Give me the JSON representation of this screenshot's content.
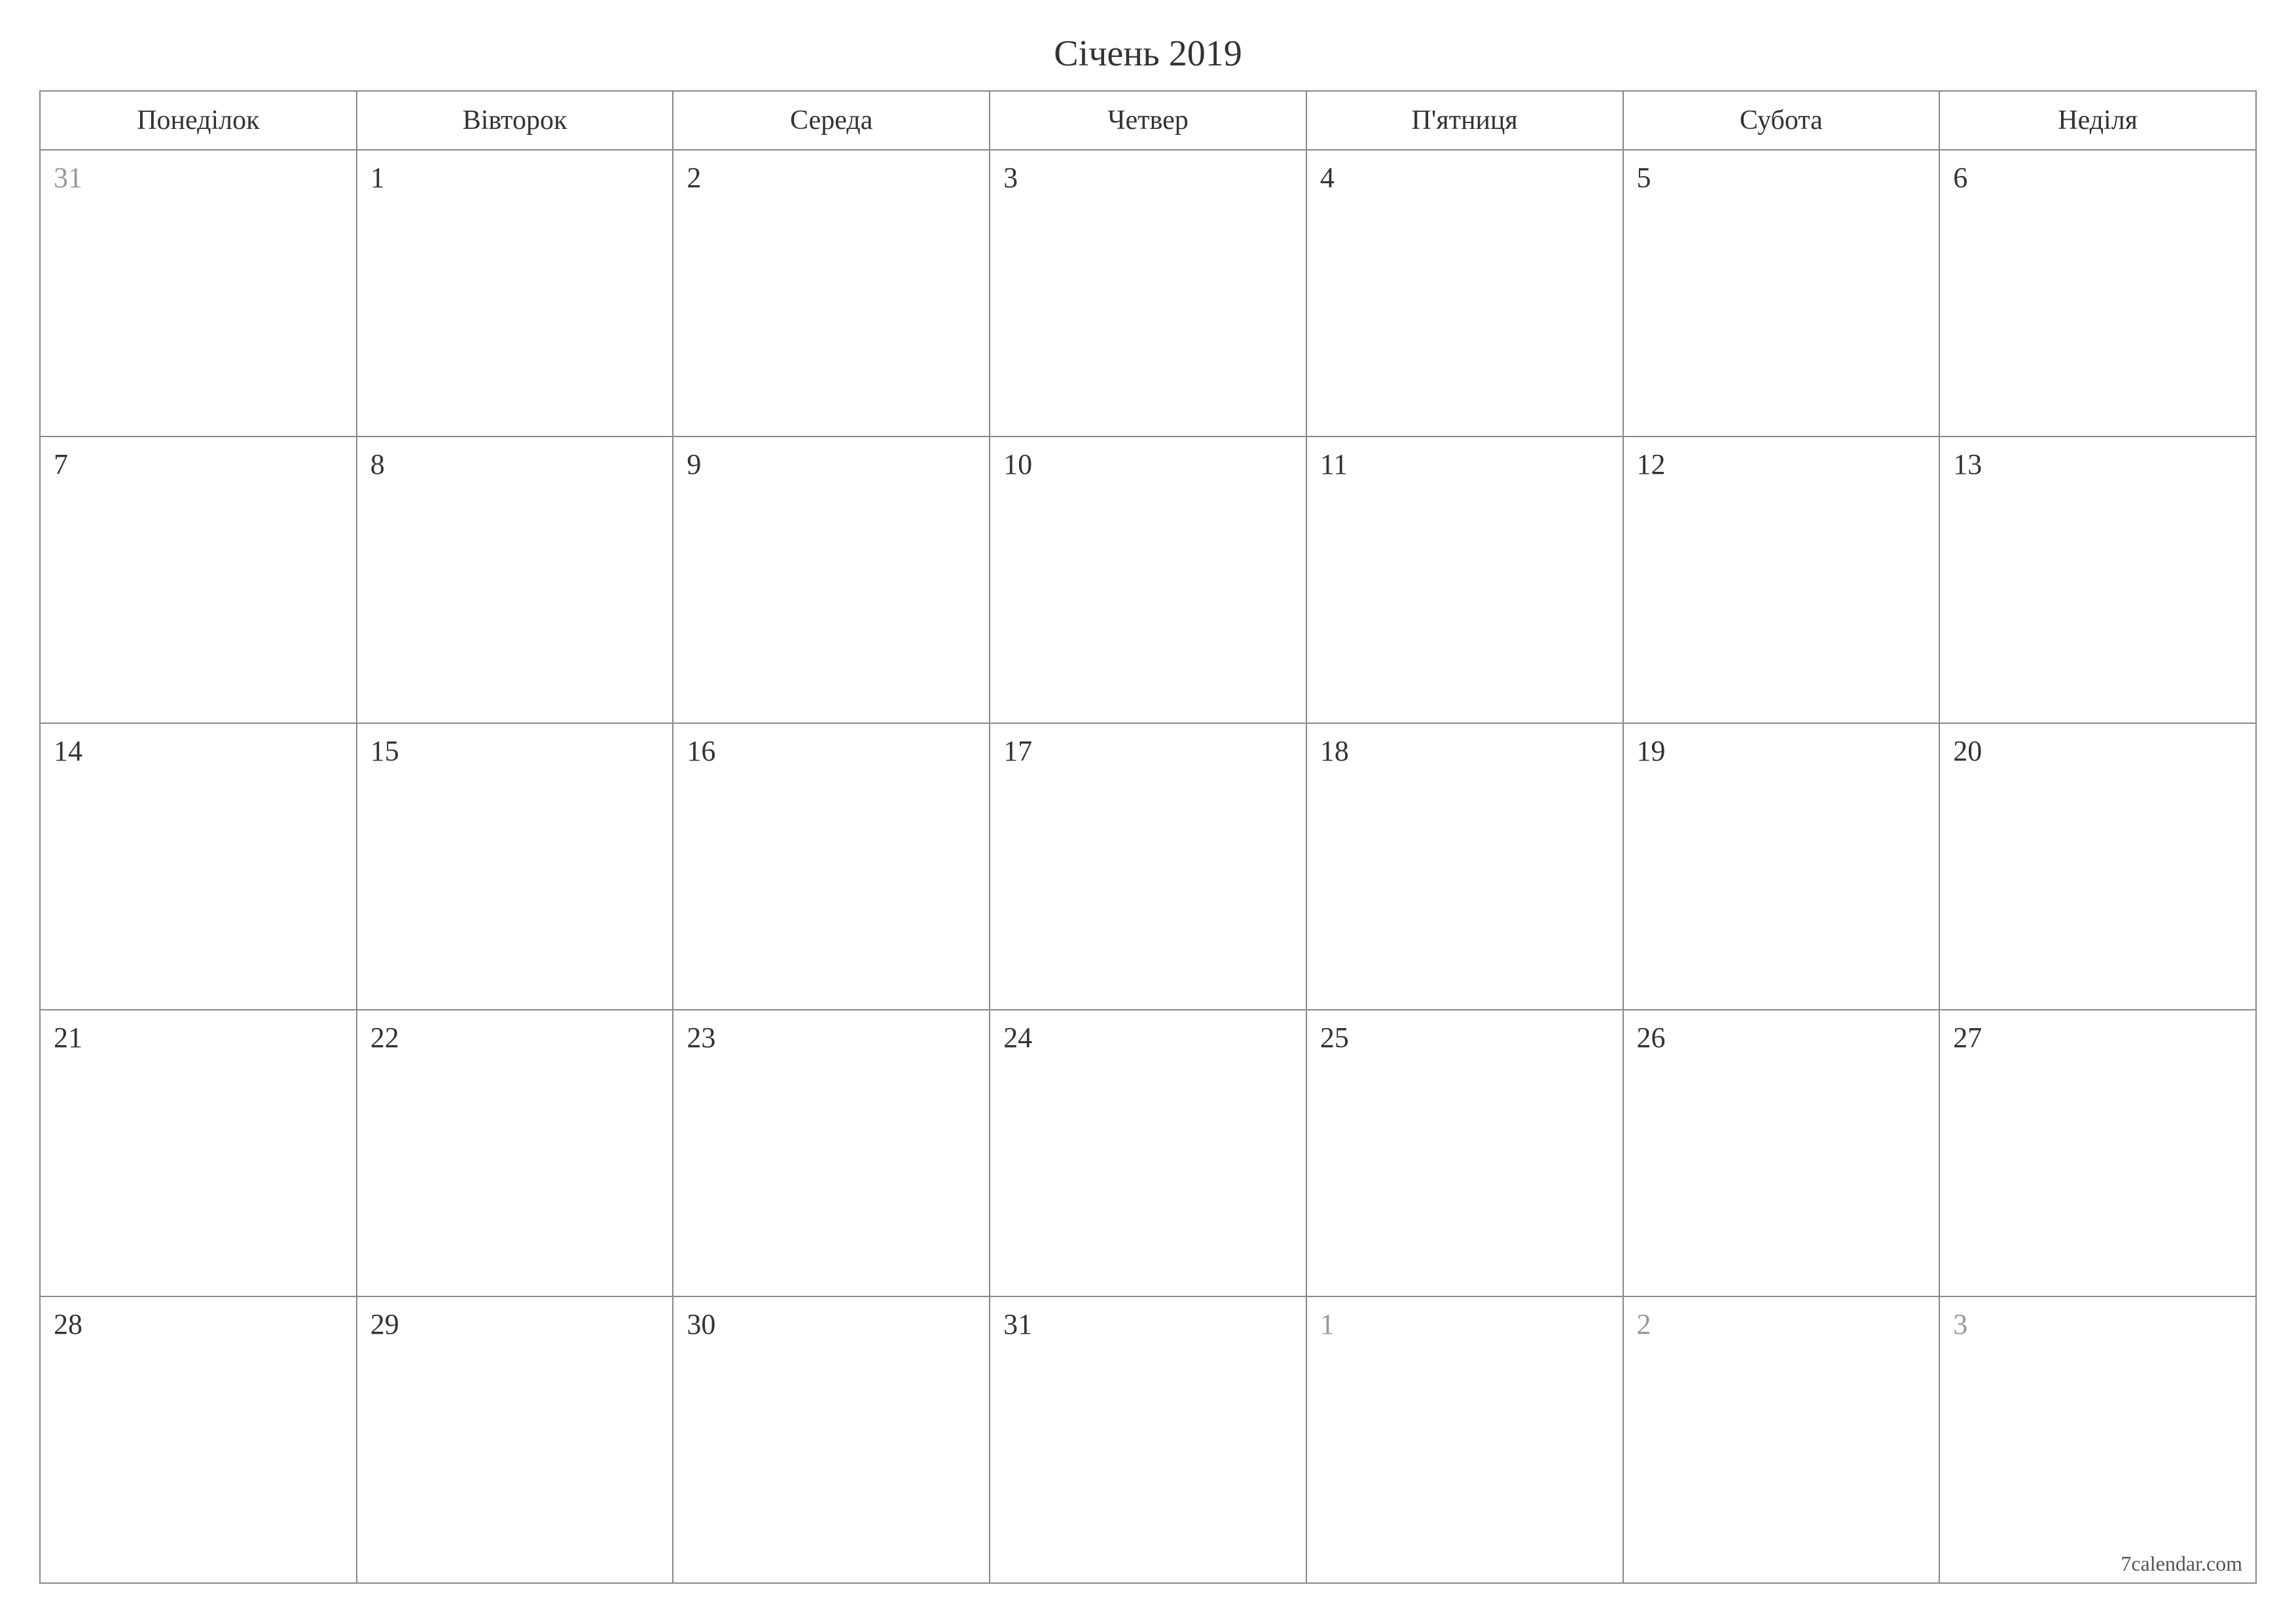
{
  "title": "Січень 2019",
  "weekdays": [
    "Понеділок",
    "Вівторок",
    "Середа",
    "Четвер",
    "П'ятниця",
    "Субота",
    "Неділя"
  ],
  "weeks": [
    [
      {
        "day": "31",
        "other": true
      },
      {
        "day": "1",
        "other": false
      },
      {
        "day": "2",
        "other": false
      },
      {
        "day": "3",
        "other": false
      },
      {
        "day": "4",
        "other": false
      },
      {
        "day": "5",
        "other": false
      },
      {
        "day": "6",
        "other": false
      }
    ],
    [
      {
        "day": "7",
        "other": false
      },
      {
        "day": "8",
        "other": false
      },
      {
        "day": "9",
        "other": false
      },
      {
        "day": "10",
        "other": false
      },
      {
        "day": "11",
        "other": false
      },
      {
        "day": "12",
        "other": false
      },
      {
        "day": "13",
        "other": false
      }
    ],
    [
      {
        "day": "14",
        "other": false
      },
      {
        "day": "15",
        "other": false
      },
      {
        "day": "16",
        "other": false
      },
      {
        "day": "17",
        "other": false
      },
      {
        "day": "18",
        "other": false
      },
      {
        "day": "19",
        "other": false
      },
      {
        "day": "20",
        "other": false
      }
    ],
    [
      {
        "day": "21",
        "other": false
      },
      {
        "day": "22",
        "other": false
      },
      {
        "day": "23",
        "other": false
      },
      {
        "day": "24",
        "other": false
      },
      {
        "day": "25",
        "other": false
      },
      {
        "day": "26",
        "other": false
      },
      {
        "day": "27",
        "other": false
      }
    ],
    [
      {
        "day": "28",
        "other": false
      },
      {
        "day": "29",
        "other": false
      },
      {
        "day": "30",
        "other": false
      },
      {
        "day": "31",
        "other": false
      },
      {
        "day": "1",
        "other": true
      },
      {
        "day": "2",
        "other": true
      },
      {
        "day": "3",
        "other": true
      }
    ]
  ],
  "footer": "7calendar.com"
}
